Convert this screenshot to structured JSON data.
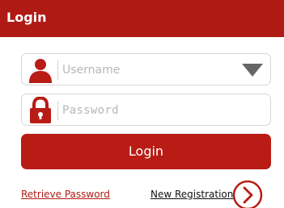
{
  "header": {
    "title": "Login"
  },
  "username": {
    "placeholder": "Username",
    "value": ""
  },
  "password": {
    "placeholder": "Password",
    "value": ""
  },
  "login_button": {
    "label": "Login"
  },
  "links": {
    "retrieve_password": "Retrieve Password",
    "new_registration": "New Registration"
  },
  "colors": {
    "brand": "#b01a14",
    "button": "#b81c15",
    "field_border": "#d6d6d6",
    "placeholder": "#b7b7b7",
    "dropdown_arrow": "#666666"
  },
  "icons": {
    "username": "user-icon",
    "password": "lock-icon",
    "dropdown": "dropdown-arrow-icon",
    "register": "chevron-right-circle-icon"
  }
}
